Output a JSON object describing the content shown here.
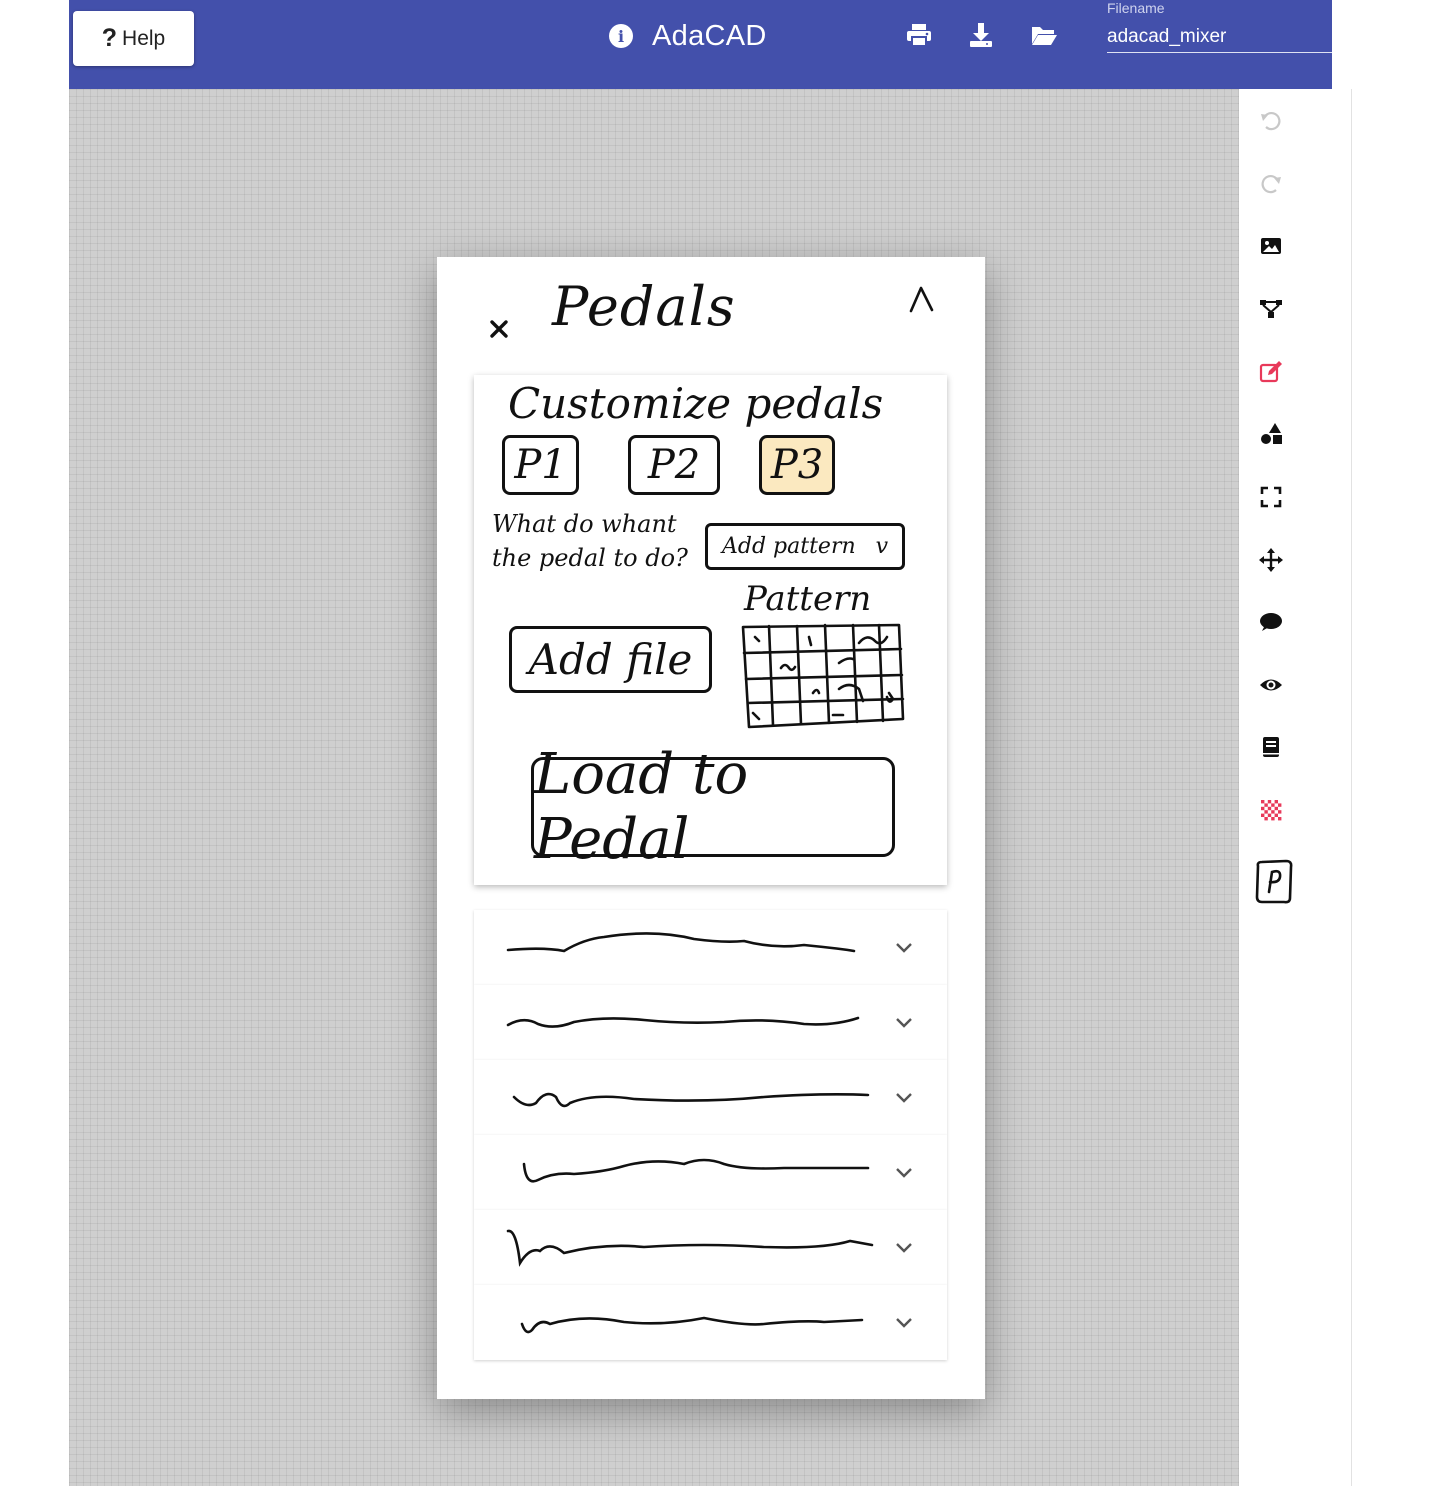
{
  "colors": {
    "toolbar_bg": "#4350ab",
    "canvas_bg": "#cfcfcf",
    "accent_red": "#e8395a",
    "highlight_yellow": "#fbe9c0"
  },
  "toolbar": {
    "help_label": "Help",
    "help_icon": "question-mark",
    "info_icon": "info-circle-icon",
    "app_title": "AdaCAD",
    "icons": [
      "print-icon",
      "download-icon",
      "folder-open-icon"
    ],
    "filename_label": "Filename",
    "filename_value": "adacad_mixer"
  },
  "rail": {
    "icons": [
      "undo-icon",
      "redo-icon",
      "image-icon",
      "network-icon",
      "edit-icon",
      "shapes-icon",
      "expand-icon",
      "move-icon",
      "comment-icon",
      "eye-icon",
      "book-icon",
      "checker-icon",
      "pedal-p-icon"
    ]
  },
  "modal": {
    "title": "Pedals",
    "close_icon": "close-icon",
    "collapse_icon": "caret-up-icon",
    "card": {
      "title": "Customize pedals",
      "pedals": [
        "P1",
        "P2",
        "P3"
      ],
      "selected_pedal": "P3",
      "question": "What do whant the pedal to do?",
      "dropdown_value": "Add pattern",
      "pattern_label": "Pattern",
      "add_file_label": "Add file",
      "load_label": "Load to Pedal"
    },
    "accordion_rows": 6
  }
}
